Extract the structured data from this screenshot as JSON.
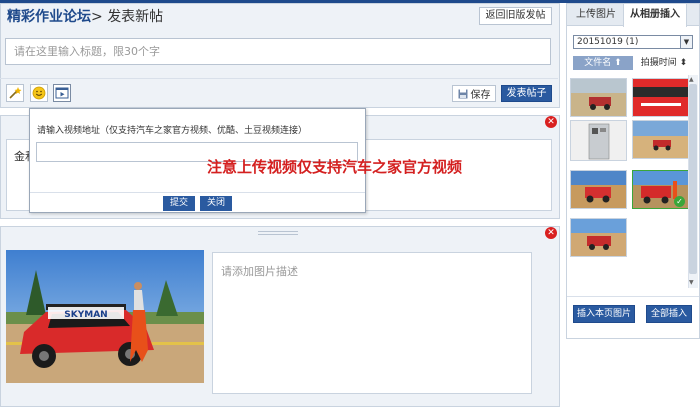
{
  "header": {
    "forum_name": "精彩作业论坛",
    "separator": ">",
    "page_title": "发表新帖",
    "old_version_label": "返回旧版发帖"
  },
  "title_field": {
    "placeholder": "请在这里输入标题，限30个字",
    "value": ""
  },
  "toolbar": {
    "wand_icon": "magic-wand-icon",
    "emoji_icon": "smiley-icon",
    "video_icon": "video-icon",
    "save_label": "保存",
    "post_label": "发表帖子"
  },
  "content_block": {
    "text": "金和"
  },
  "video_popup": {
    "prompt": "请输入视频地址（仅支持汽车之家官方视频、优酷、土豆视频连接）",
    "url_value": "",
    "submit_label": "提交",
    "close_label": "关闭"
  },
  "notice": "注意上传视频仅支持汽车之家官方视频",
  "image_block": {
    "caption_placeholder": "请添加图片描述",
    "photo_text": "SKYMAN"
  },
  "sidebar": {
    "tabs": [
      {
        "label": "上传图片",
        "active": false
      },
      {
        "label": "从相册插入",
        "active": true
      }
    ],
    "album_selected": "20151019 (1)",
    "sort_name_label": "文件名 ⬆",
    "sort_time_label": "拍摄时间 ⬍",
    "thumbnails": [
      {
        "name": "rally-car-desert-1",
        "selected": false
      },
      {
        "name": "red-banner-1",
        "selected": false
      },
      {
        "name": "machine-room-1",
        "selected": false
      },
      {
        "name": "rally-car-desert-2",
        "selected": false
      },
      {
        "name": "rally-car-desert-3",
        "selected": false
      },
      {
        "name": "rally-car-driver",
        "selected": true
      },
      {
        "name": "rally-car-desert-4",
        "selected": false
      }
    ],
    "insert_page_label": "插入本页图片",
    "insert_all_label": "全部插入"
  },
  "colors": {
    "brand_blue": "#1f4a8c",
    "button_blue": "#2a5aa0",
    "notice_red": "#d42020",
    "panel_bg": "#eef2f7"
  }
}
